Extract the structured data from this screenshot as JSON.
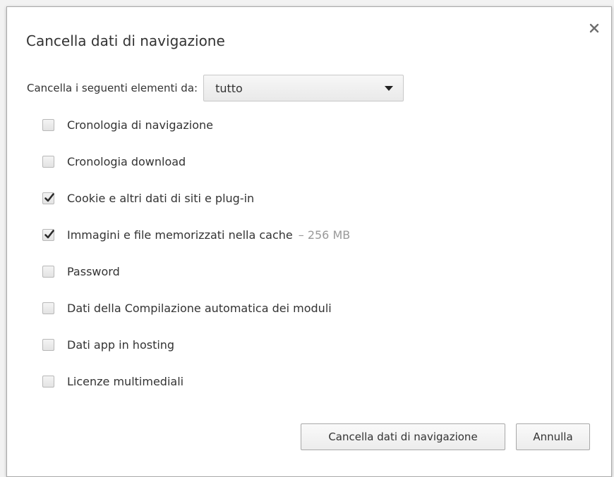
{
  "dialog": {
    "title": "Cancella dati di navigazione",
    "close_icon": "close-icon"
  },
  "range": {
    "label": "Cancella i seguenti elementi da:",
    "selected": "tutto"
  },
  "options": [
    {
      "label": "Cronologia di navigazione",
      "checked": false,
      "size": ""
    },
    {
      "label": "Cronologia download",
      "checked": false,
      "size": ""
    },
    {
      "label": "Cookie e altri dati di siti e plug-in",
      "checked": true,
      "size": ""
    },
    {
      "label": "Immagini e file memorizzati nella cache",
      "checked": true,
      "size": "–  256 MB"
    },
    {
      "label": "Password",
      "checked": false,
      "size": ""
    },
    {
      "label": "Dati della Compilazione automatica dei moduli",
      "checked": false,
      "size": ""
    },
    {
      "label": "Dati app in hosting",
      "checked": false,
      "size": ""
    },
    {
      "label": "Licenze multimediali",
      "checked": false,
      "size": ""
    }
  ],
  "buttons": {
    "clear_label": "Cancella dati di navigazione",
    "cancel_label": "Annulla"
  },
  "colors": {
    "text": "#333333",
    "muted": "#999999",
    "border": "#a9a9a9"
  }
}
